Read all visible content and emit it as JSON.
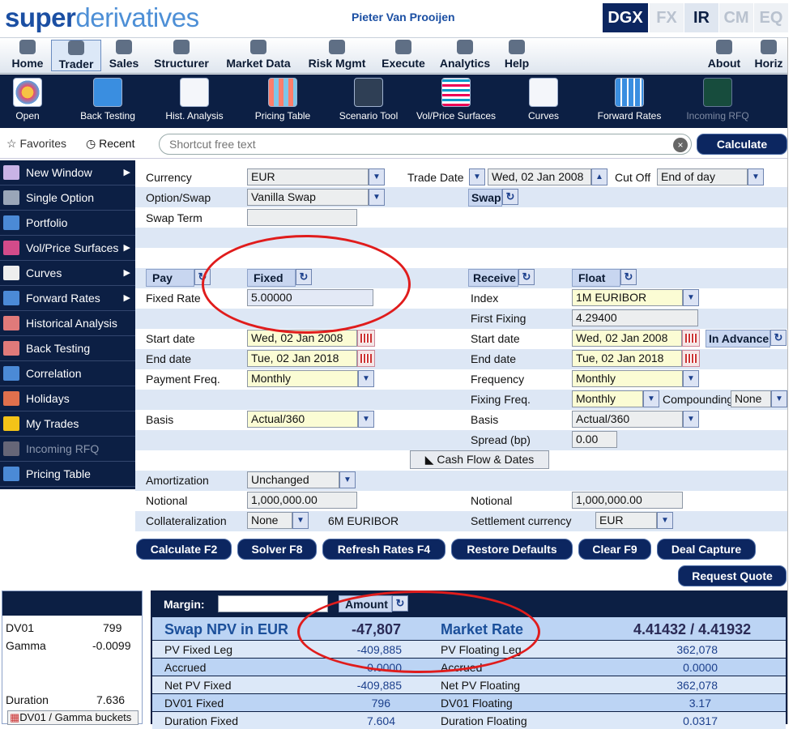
{
  "app": {
    "logo_bold": "super",
    "logo_light": "derivatives",
    "user": "Pieter Van Prooijen",
    "products": [
      "DGX",
      "FX",
      "IR",
      "CM",
      "EQ"
    ],
    "active_product": "IR"
  },
  "menu": [
    "Home",
    "Trader",
    "Sales",
    "Structurer",
    "Market Data",
    "Risk Mgmt",
    "Execute",
    "Analytics",
    "Help",
    "About",
    "Horiz"
  ],
  "toolbar": [
    "Open",
    "Back Testing",
    "Hist. Analysis",
    "Pricing Table",
    "Scenario Tool",
    "Vol/Price Surfaces",
    "Curves",
    "Forward Rates",
    "Incoming RFQ"
  ],
  "shortcuts": {
    "favorites": "Favorites",
    "recent": "Recent",
    "placeholder": "Shortcut free text",
    "calculate": "Calculate"
  },
  "sidebar": [
    "New Window",
    "Single Option",
    "Portfolio",
    "Vol/Price Surfaces",
    "Curves",
    "Forward Rates",
    "Historical Analysis",
    "Back Testing",
    "Correlation",
    "Holidays",
    "My Trades",
    "Incoming RFQ",
    "Pricing Table"
  ],
  "form": {
    "currency_label": "Currency",
    "currency": "EUR",
    "trade_date_label": "Trade Date",
    "trade_date": "Wed, 02 Jan 2008",
    "cutoff_label": "Cut Off",
    "cutoff": "End of day",
    "option_label": "Option/Swap",
    "option": "Vanilla Swap",
    "swap_btn": "Swap",
    "swap_term_label": "Swap Term",
    "pay": "Pay",
    "fixed": "Fixed",
    "receive": "Receive",
    "float": "Float",
    "fixed_rate_label": "Fixed Rate",
    "fixed_rate": "5.00000",
    "index_label": "Index",
    "index": "1M EURIBOR",
    "first_fixing_label": "First Fixing",
    "first_fixing": "4.29400",
    "start_label": "Start date",
    "start_pay": "Wed, 02 Jan 2008",
    "start_rec": "Wed, 02 Jan 2008",
    "in_advance": "In Advance",
    "end_label": "End date",
    "end_pay": "Tue, 02 Jan 2018",
    "end_rec": "Tue, 02 Jan 2018",
    "payfreq_label": "Payment Freq.",
    "payfreq": "Monthly",
    "freq_label": "Frequency",
    "freq": "Monthly",
    "fixfreq_label": "Fixing Freq.",
    "fixfreq": "Monthly",
    "compounding_label": "Compounding",
    "compounding": "None",
    "basis_label": "Basis",
    "basis_pay": "Actual/360",
    "basis_rec": "Actual/360",
    "spread_label": "Spread (bp)",
    "spread": "0.00",
    "cashflow": "Cash Flow & Dates",
    "amort_label": "Amortization",
    "amort": "Unchanged",
    "notional_label": "Notional",
    "notional_pay": "1,000,000.00",
    "notional_rec": "1,000,000.00",
    "collat_label": "Collateralization",
    "collat": "None",
    "collat_index": "6M EURIBOR",
    "settle_label": "Settlement currency",
    "settle": "EUR"
  },
  "buttons": [
    "Calculate F2",
    "Solver F8",
    "Refresh Rates F4",
    "Restore Defaults",
    "Clear F9",
    "Deal Capture"
  ],
  "request_quote": "Request Quote",
  "left_results": {
    "dv01_label": "DV01",
    "dv01": "799",
    "gamma_label": "Gamma",
    "gamma": "-0.0099",
    "duration_label": "Duration",
    "duration": "7.636",
    "buckets": "DV01 / Gamma buckets"
  },
  "results": {
    "margin_label": "Margin:",
    "amount": "Amount",
    "npv_label": "Swap NPV in EUR",
    "npv": "-47,807",
    "market_rate_label": "Market Rate",
    "market_rate": "4.41432 / 4.41932",
    "rows": [
      {
        "l": "PV Fixed Leg",
        "v": "-409,885",
        "l2": "PV Floating Leg",
        "v2": "362,078"
      },
      {
        "l": "Accrued",
        "v": "0.0000",
        "l2": "Accrued",
        "v2": "0.0000"
      },
      {
        "l": "Net PV Fixed",
        "v": "-409,885",
        "l2": "Net PV Floating",
        "v2": "362,078"
      },
      {
        "l": "DV01 Fixed",
        "v": "796",
        "l2": "DV01 Floating",
        "v2": "3.17"
      },
      {
        "l": "Duration Fixed",
        "v": "7.604",
        "l2": "Duration Floating",
        "v2": "0.0317"
      }
    ]
  },
  "colors": {
    "navy": "#0c1f44",
    "brand": "#1b4fa3",
    "annotation": "#e01c1c"
  }
}
